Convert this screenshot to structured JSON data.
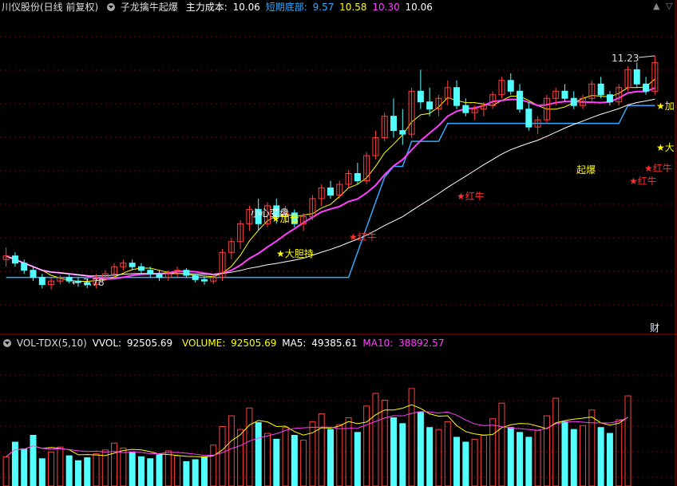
{
  "header": {
    "stock_name": "川仪股份(日线 前复权)",
    "indicator_name": "子龙擒牛起爆",
    "cost_label": "主力成本:",
    "cost_value": "10.06",
    "bottom_label": "短期底部:",
    "bottom_value": "9.57",
    "v2": "10.58",
    "v3": "10.30",
    "v4": "10.06"
  },
  "vol_header": {
    "name": "VOL-TDX(5,10)",
    "vvol_label": "VVOL:",
    "vvol": "92505.69",
    "volume_label": "VOLUME:",
    "volume": "92505.69",
    "ma5_label": "MA5:",
    "ma5": "49385.61",
    "ma10_label": "MA10:",
    "ma10": "38892.57"
  },
  "price_labels": {
    "high": "11.23",
    "low": "7.78",
    "cai": "财"
  },
  "signals": [
    {
      "text": "小心变盘",
      "color": "#ffffff"
    },
    {
      "text": "★加仓",
      "color": "#ffff00"
    },
    {
      "text": "★大胆持",
      "color": "#ffff00"
    },
    {
      "text": "★红牛",
      "color": "#ff3030"
    },
    {
      "text": "★红牛",
      "color": "#ff3030"
    },
    {
      "text": "起爆",
      "color": "#ffff00"
    },
    {
      "text": "★红牛",
      "color": "#ff3030"
    },
    {
      "text": "★红牛",
      "color": "#ff3030"
    },
    {
      "text": "★加",
      "color": "#ffff00"
    },
    {
      "text": "★大",
      "color": "#ffff00"
    }
  ],
  "colors": {
    "up": "#ff4040",
    "down": "#54ffff",
    "ma_short": "#ffff00",
    "ma_mid": "#ff40ff",
    "ma_long": "#ffffff",
    "cost_line": "#33aaff",
    "grid": "#800000"
  },
  "chart_data": {
    "type": "candlestick",
    "price_range": [
      7.2,
      11.6
    ],
    "series_candles": [
      [
        8.2,
        8.37,
        8.1,
        8.25
      ],
      [
        8.25,
        8.3,
        8.1,
        8.15
      ],
      [
        8.15,
        8.2,
        8.0,
        8.05
      ],
      [
        8.05,
        8.1,
        7.9,
        7.95
      ],
      [
        7.95,
        8.0,
        7.8,
        7.85
      ],
      [
        7.85,
        7.95,
        7.78,
        7.9
      ],
      [
        7.9,
        7.98,
        7.85,
        7.95
      ],
      [
        7.95,
        8.0,
        7.87,
        7.9
      ],
      [
        7.9,
        7.95,
        7.82,
        7.88
      ],
      [
        7.88,
        7.92,
        7.8,
        7.85
      ],
      [
        7.85,
        8.0,
        7.8,
        7.95
      ],
      [
        7.95,
        8.05,
        7.9,
        8.0
      ],
      [
        8.0,
        8.15,
        7.95,
        8.1
      ],
      [
        8.1,
        8.2,
        8.05,
        8.15
      ],
      [
        8.15,
        8.2,
        8.05,
        8.1
      ],
      [
        8.1,
        8.15,
        8.0,
        8.05
      ],
      [
        8.05,
        8.1,
        7.95,
        8.0
      ],
      [
        8.0,
        8.05,
        7.9,
        7.95
      ],
      [
        7.95,
        8.05,
        7.9,
        8.0
      ],
      [
        8.0,
        8.1,
        7.95,
        8.05
      ],
      [
        8.05,
        8.08,
        7.95,
        7.98
      ],
      [
        7.98,
        8.0,
        7.88,
        7.92
      ],
      [
        7.92,
        7.96,
        7.85,
        7.9
      ],
      [
        7.9,
        8.0,
        7.86,
        7.95
      ],
      [
        7.95,
        8.35,
        7.9,
        8.3
      ],
      [
        8.3,
        8.5,
        8.2,
        8.45
      ],
      [
        8.45,
        8.75,
        8.35,
        8.7
      ],
      [
        8.7,
        8.95,
        8.6,
        8.9
      ],
      [
        8.9,
        9.05,
        8.6,
        8.7
      ],
      [
        8.7,
        9.0,
        8.65,
        8.95
      ],
      [
        8.95,
        9.05,
        8.7,
        8.8
      ],
      [
        8.8,
        8.95,
        8.7,
        8.85
      ],
      [
        8.85,
        8.9,
        8.65,
        8.7
      ],
      [
        8.7,
        8.85,
        8.6,
        8.8
      ],
      [
        8.8,
        9.1,
        8.75,
        9.05
      ],
      [
        9.05,
        9.25,
        8.95,
        9.2
      ],
      [
        9.2,
        9.3,
        9.05,
        9.1
      ],
      [
        9.1,
        9.3,
        9.05,
        9.25
      ],
      [
        9.25,
        9.45,
        9.2,
        9.4
      ],
      [
        9.4,
        9.55,
        9.25,
        9.3
      ],
      [
        9.3,
        9.7,
        9.25,
        9.65
      ],
      [
        9.65,
        10.0,
        9.6,
        9.9
      ],
      [
        9.9,
        10.25,
        9.85,
        10.2
      ],
      [
        10.2,
        10.45,
        9.9,
        10.0
      ],
      [
        10.0,
        10.3,
        9.8,
        9.95
      ],
      [
        9.95,
        10.6,
        9.9,
        10.55
      ],
      [
        10.55,
        10.85,
        10.3,
        10.4
      ],
      [
        10.4,
        10.6,
        10.2,
        10.3
      ],
      [
        10.3,
        10.5,
        10.2,
        10.45
      ],
      [
        10.45,
        10.7,
        10.35,
        10.6
      ],
      [
        10.6,
        10.7,
        10.3,
        10.35
      ],
      [
        10.35,
        10.45,
        10.2,
        10.25
      ],
      [
        10.25,
        10.35,
        10.15,
        10.3
      ],
      [
        10.3,
        10.4,
        10.2,
        10.35
      ],
      [
        10.35,
        10.55,
        10.3,
        10.5
      ],
      [
        10.5,
        10.75,
        10.45,
        10.7
      ],
      [
        10.7,
        10.8,
        10.5,
        10.55
      ],
      [
        10.55,
        10.65,
        10.25,
        10.3
      ],
      [
        10.3,
        10.4,
        10.0,
        10.05
      ],
      [
        10.05,
        10.2,
        9.95,
        10.15
      ],
      [
        10.15,
        10.5,
        10.1,
        10.45
      ],
      [
        10.45,
        10.6,
        10.35,
        10.55
      ],
      [
        10.55,
        10.65,
        10.4,
        10.45
      ],
      [
        10.45,
        10.55,
        10.3,
        10.35
      ],
      [
        10.35,
        10.5,
        10.3,
        10.45
      ],
      [
        10.45,
        10.7,
        10.4,
        10.65
      ],
      [
        10.65,
        10.75,
        10.45,
        10.5
      ],
      [
        10.5,
        10.55,
        10.35,
        10.4
      ],
      [
        10.4,
        10.65,
        10.35,
        10.6
      ],
      [
        10.6,
        10.9,
        10.55,
        10.85
      ],
      [
        10.85,
        10.95,
        10.6,
        10.65
      ],
      [
        10.65,
        10.75,
        10.5,
        10.55
      ],
      [
        10.55,
        11.05,
        10.5,
        10.95
      ]
    ],
    "volume_range": [
      0,
      140000
    ],
    "volume": [
      30000,
      45000,
      38000,
      52000,
      28000,
      35000,
      40000,
      31000,
      26000,
      29000,
      33000,
      37000,
      44000,
      39000,
      35000,
      30000,
      28000,
      32000,
      36000,
      31000,
      25000,
      27000,
      30000,
      42000,
      61000,
      72000,
      58000,
      80000,
      65000,
      54000,
      48000,
      60000,
      52000,
      47000,
      66000,
      74000,
      58000,
      63000,
      70000,
      55000,
      82000,
      95000,
      88000,
      70000,
      64000,
      100000,
      76000,
      60000,
      58000,
      66000,
      50000,
      45000,
      48000,
      52000,
      69000,
      85000,
      60000,
      55000,
      50000,
      57000,
      72000,
      90000,
      66000,
      58000,
      62000,
      78000,
      60000,
      54000,
      68000,
      92505
    ],
    "ma5_last": 49385.61,
    "ma10_last": 38892.57
  }
}
